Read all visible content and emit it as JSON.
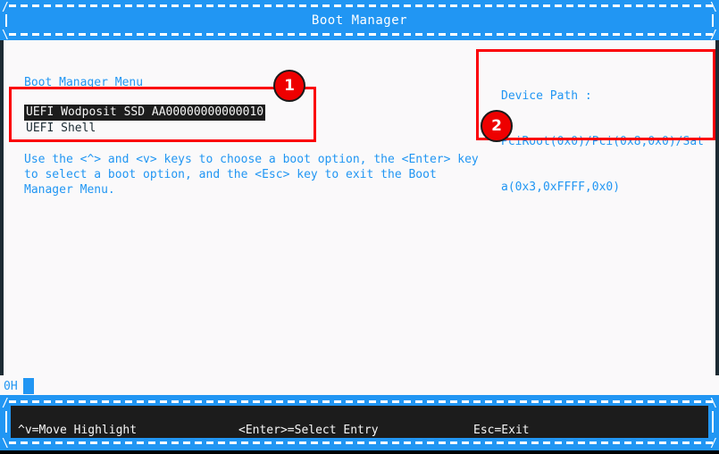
{
  "window": {
    "title": "Boot Manager"
  },
  "titlebar": {
    "corner_tl": "/",
    "corner_tr": "\\",
    "corner_bl": "\\",
    "corner_br": "/"
  },
  "main": {
    "menu_heading": "Boot Manager Menu",
    "boot_options": [
      {
        "label": "UEFI Wodposit SSD AA00000000000010",
        "selected": true
      },
      {
        "label": "UEFI Shell",
        "selected": false
      }
    ],
    "help_text": "Use the <^> and <v> keys to choose a boot option, the <Enter> key to select a boot option, and the <Esc> key to exit the Boot Manager Menu.",
    "device_path": {
      "label": "Device Path :",
      "line1": "PciRoot(0x0)/Pci(0x8,0x0)/Sat",
      "line2": "a(0x3,0xFFFF,0x0)"
    }
  },
  "console": {
    "cursor_text": "0H"
  },
  "statusbar": {
    "keys": [
      "^v=Move Highlight",
      "<Enter>=Select Entry",
      "Esc=Exit"
    ],
    "corner_tl": "/",
    "corner_tr": "\\",
    "corner_bl": "\\",
    "corner_br": "/"
  },
  "annotations": [
    {
      "number": "1"
    },
    {
      "number": "2"
    }
  ],
  "colors": {
    "accent_blue": "#2196f3",
    "annotation_red": "#fb0007",
    "badge_red": "#ee0000",
    "panel_dark": "#1c1c1c",
    "screen_bg": "#faf9fa"
  }
}
